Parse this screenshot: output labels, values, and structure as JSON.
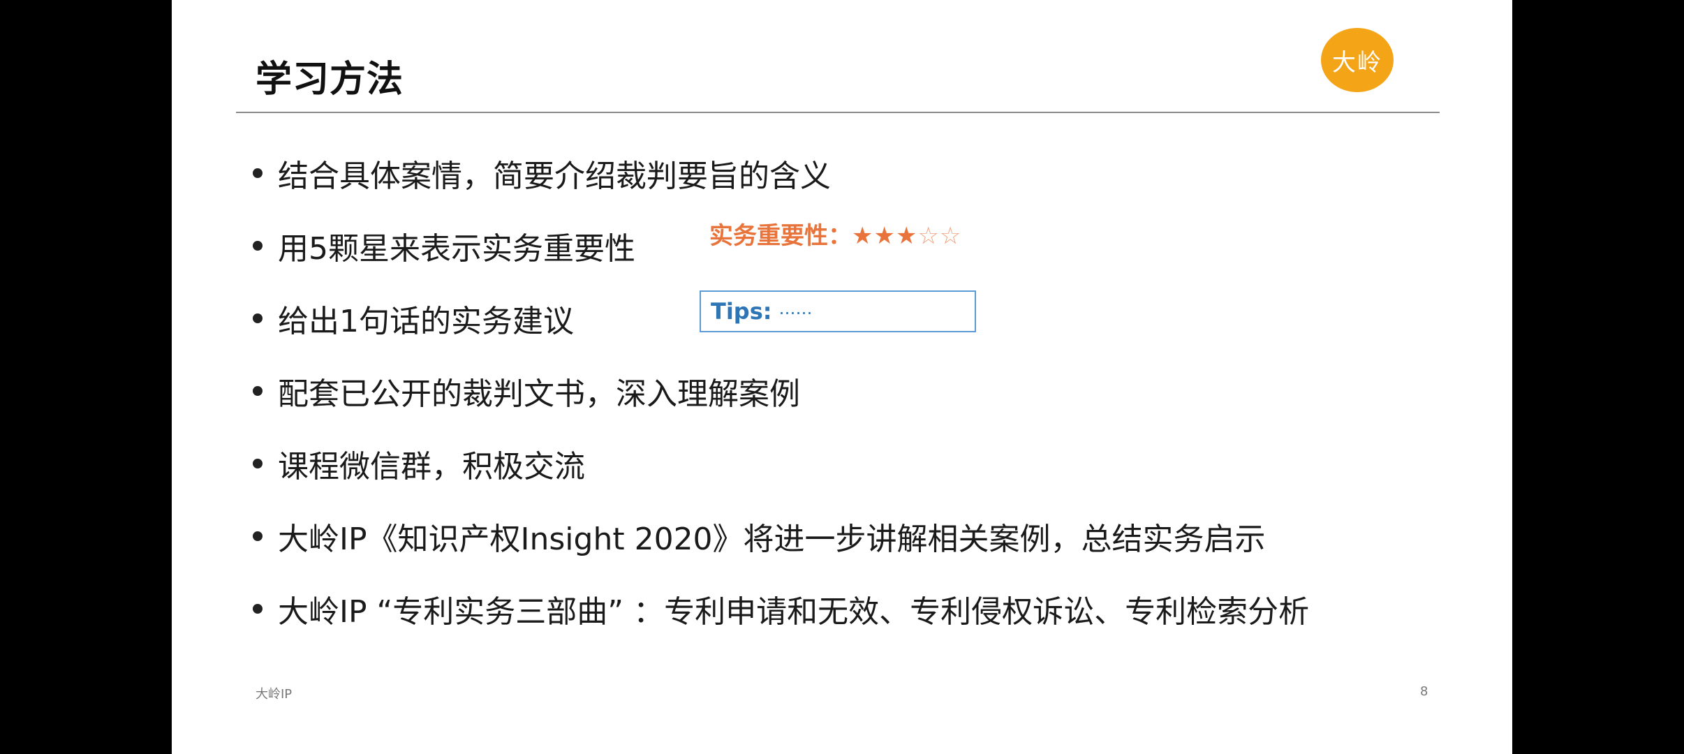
{
  "slide": {
    "title": "学习方法",
    "logo_text": "大岭",
    "bullets": [
      "结合具体案情，简要介绍裁判要旨的含义",
      "用5颗星来表示实务重要性",
      "给出1句话的实务建议",
      "配套已公开的裁判文书，深入理解案例",
      "课程微信群，积极交流",
      "大岭IP《知识产权Insight 2020》将进一步讲解相关案例，总结实务启示",
      "大岭IP “专利实务三部曲” ：专利申请和无效、专利侵权诉讼、专利检索分析"
    ],
    "importance": {
      "label": "实务重要性：",
      "stars_filled": "★★★",
      "stars_empty": "☆☆",
      "rating": 3,
      "max": 5
    },
    "tips": {
      "label": "Tips:",
      "placeholder": "……"
    },
    "footer": {
      "left": "大岭IP",
      "page_number": "8"
    }
  },
  "colors": {
    "logo": "#f4a417",
    "importance": "#e8743b",
    "tips_border": "#5b9bd5",
    "tips_text": "#2e75b6"
  }
}
